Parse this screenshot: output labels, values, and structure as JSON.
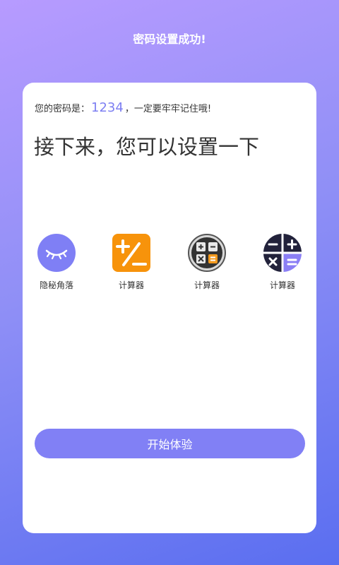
{
  "header": {
    "title": "密码设置成功!"
  },
  "card": {
    "password_prefix": "您的密码是：",
    "password_value": "1234",
    "password_suffix": "，一定要牢牢记住哦!",
    "heading": "接下来，您可以设置一下"
  },
  "icons": [
    {
      "label": "隐秘角落",
      "icon": "eye-closed-icon",
      "color": "#7f7ff5"
    },
    {
      "label": "计算器",
      "icon": "orange-calculator-icon",
      "color": "#f7930b"
    },
    {
      "label": "计算器",
      "icon": "gray-calculator-icon",
      "color": "#444444"
    },
    {
      "label": "计算器",
      "icon": "dark-calculator-icon",
      "color": "#22223b"
    }
  ],
  "actions": {
    "start_label": "开始体验"
  }
}
